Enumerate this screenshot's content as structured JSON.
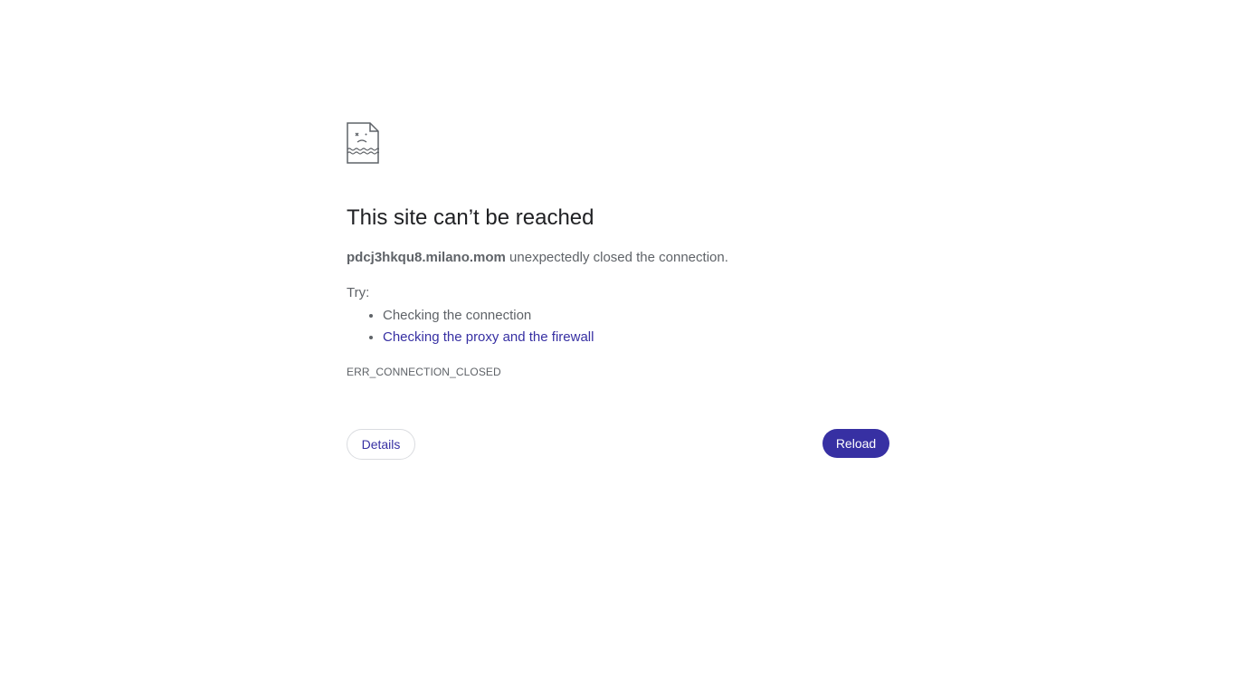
{
  "icon": "sad-page-icon",
  "heading": "This site can’t be reached",
  "summary": {
    "host": "pdcj3hkqu8.milano.mom",
    "message": " unexpectedly closed the connection."
  },
  "try_label": "Try:",
  "suggestions": [
    {
      "text": "Checking the connection",
      "link": false
    },
    {
      "text": "Checking the proxy and the firewall",
      "link": true
    }
  ],
  "error_code": "ERR_CONNECTION_CLOSED",
  "buttons": {
    "details": "Details",
    "reload": "Reload"
  },
  "colors": {
    "accent": "#3730a3",
    "text": "#5f6368",
    "heading": "#202124"
  }
}
